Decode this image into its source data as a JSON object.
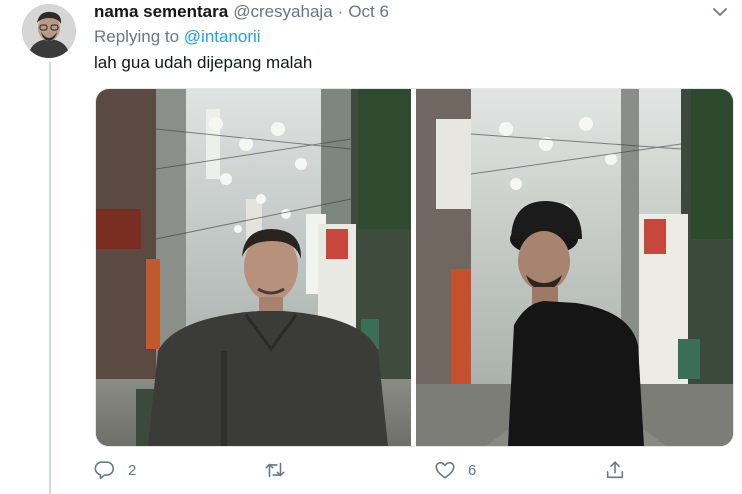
{
  "tweet": {
    "author_name": "nama sementara",
    "author_handle": "@cresyahaja",
    "separator": "·",
    "date": "Oct 6",
    "replying_prefix": "Replying to",
    "replying_handle": "@intanorii",
    "text": "lah gua udah dijepang malah"
  },
  "actions": {
    "reply_count": "2",
    "retweet_count": "",
    "like_count": "6"
  },
  "colors": {
    "link": "#1da1f2",
    "secondary_text": "#657786",
    "thread_line": "#cfd9de"
  },
  "icons": [
    "chevron-down-icon",
    "reply-icon",
    "retweet-icon",
    "like-icon",
    "share-icon"
  ]
}
